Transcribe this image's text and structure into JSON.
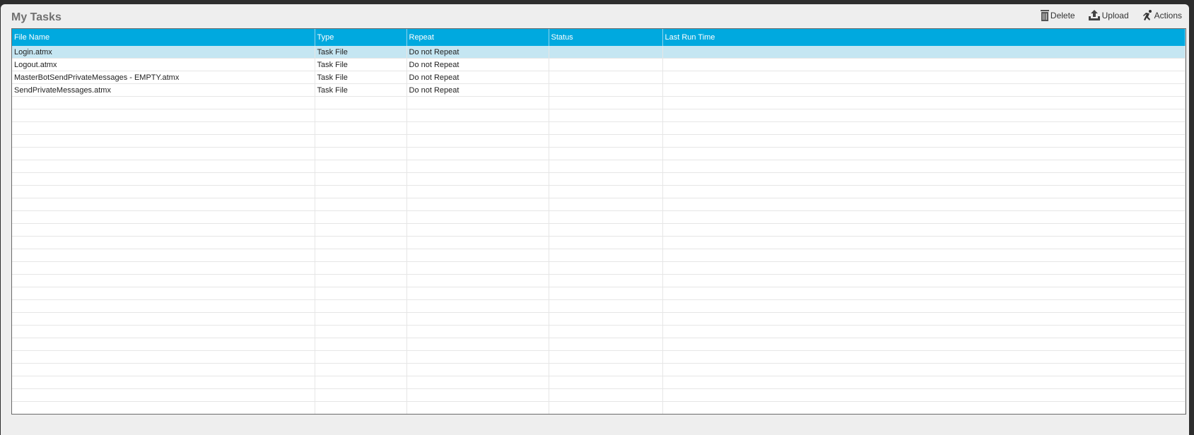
{
  "title": "My Tasks",
  "toolbar": {
    "delete": "Delete",
    "upload": "Upload",
    "actions": "Actions"
  },
  "columns": [
    "File Name",
    "Type",
    "Repeat",
    "Status",
    "Last Run Time"
  ],
  "rows": [
    [
      "Login.atmx",
      "Task File",
      "Do not Repeat",
      "",
      ""
    ],
    [
      "Logout.atmx",
      "Task File",
      "Do not Repeat",
      "",
      ""
    ],
    [
      "MasterBotSendPrivateMessages - EMPTY.atmx",
      "Task File",
      "Do not Repeat",
      "",
      ""
    ],
    [
      "SendPrivateMessages.atmx",
      "Task File",
      "Do not Repeat",
      "",
      ""
    ]
  ],
  "selected_row": 0,
  "colors": {
    "header": "#00a9df",
    "selected": "#c5e6f2"
  }
}
